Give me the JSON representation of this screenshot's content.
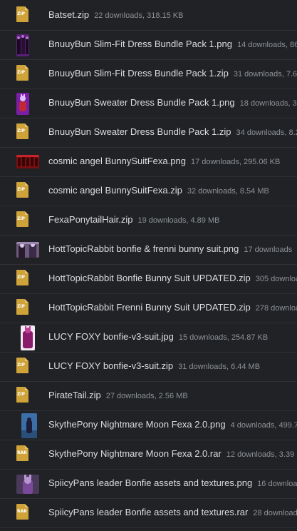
{
  "files": [
    {
      "name": "Batset.zip",
      "meta": "22 downloads, 318.15 KB",
      "kind": "zip",
      "icon_label": "ZIP"
    },
    {
      "name": "BnuuyBun Slim-Fit Dress Bundle Pack 1.png",
      "meta": "14 downloads, 866",
      "kind": "image"
    },
    {
      "name": "BnuuyBun Slim-Fit Dress Bundle Pack 1.zip",
      "meta": "31 downloads, 7.68",
      "kind": "zip",
      "icon_label": "ZIP"
    },
    {
      "name": "BnuuyBun Sweater Dress Bundle Pack 1.png",
      "meta": "18 downloads, 364",
      "kind": "image"
    },
    {
      "name": "BnuuyBun Sweater Dress Bundle Pack 1.zip",
      "meta": "34 downloads, 8.25",
      "kind": "zip",
      "icon_label": "ZIP"
    },
    {
      "name": "cosmic angel BunnySuitFexa.png",
      "meta": "17 downloads, 295.06 KB",
      "kind": "image"
    },
    {
      "name": "cosmic angel BunnySuitFexa.zip",
      "meta": "32 downloads, 8.54 MB",
      "kind": "zip",
      "icon_label": "ZIP"
    },
    {
      "name": "FexaPonytailHair.zip",
      "meta": "19 downloads, 4.89 MB",
      "kind": "zip",
      "icon_label": "ZIP"
    },
    {
      "name": "HottTopicRabbit bonfie & frenni bunny suit.png",
      "meta": "17 downloads",
      "kind": "image"
    },
    {
      "name": "HottTopicRabbit Bonfie Bunny Suit UPDATED.zip",
      "meta": "305 downloa",
      "kind": "zip",
      "icon_label": "ZIP"
    },
    {
      "name": "HottTopicRabbit Frenni Bunny Suit UPDATED.zip",
      "meta": "278 downloa",
      "kind": "zip",
      "icon_label": "ZIP"
    },
    {
      "name": "LUCY FOXY bonfie-v3-suit.jpg",
      "meta": "15 downloads, 254.87 KB",
      "kind": "image"
    },
    {
      "name": "LUCY FOXY bonfie-v3-suit.zip",
      "meta": "31 downloads, 6.44 MB",
      "kind": "zip",
      "icon_label": "ZIP"
    },
    {
      "name": "PirateTail.zip",
      "meta": "27 downloads, 2.56 MB",
      "kind": "zip",
      "icon_label": "ZIP"
    },
    {
      "name": "SkythePony Nightmare Moon Fexa 2.0.png",
      "meta": "4 downloads, 499.73",
      "kind": "image"
    },
    {
      "name": "SkythePony Nightmare Moon Fexa 2.0.rar",
      "meta": "12 downloads, 3.39 M",
      "kind": "rar",
      "icon_label": "RAR"
    },
    {
      "name": "SpiicyPans leader Bonfie assets and textures.png",
      "meta": "16 download",
      "kind": "image"
    },
    {
      "name": "SpiicyPans leader Bonfie assets and textures.rar",
      "meta": "28 downloads,",
      "kind": "rar",
      "icon_label": "RAR"
    }
  ],
  "colors": {
    "background": "#202225",
    "row_divider": "#2e3035",
    "name_text": "#dcddde",
    "meta_text": "#8e9297",
    "archive_icon": "#cfa33a"
  }
}
